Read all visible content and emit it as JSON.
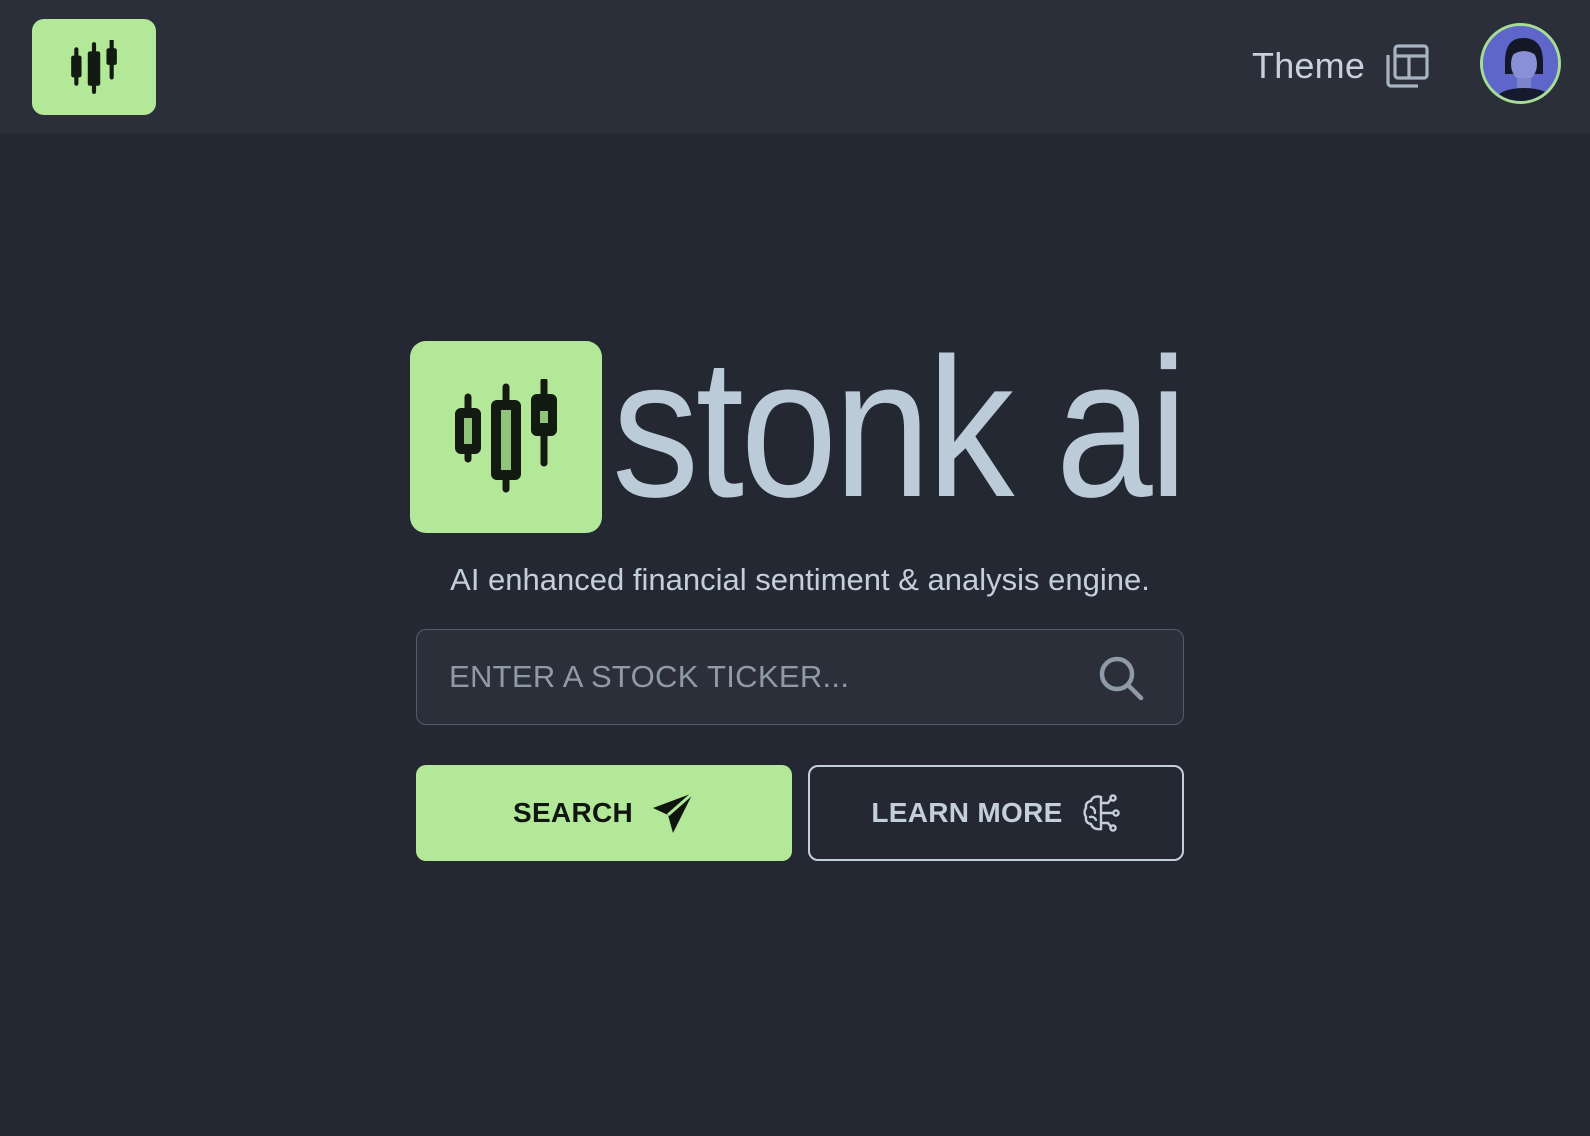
{
  "colors": {
    "accent": "#b2e897",
    "background": "#242833",
    "header_background": "#2b2f3a",
    "text": "#bccbd8",
    "icon_dark": "#121a12"
  },
  "header": {
    "logo_icon": "candlestick-chart-icon",
    "theme_label": "Theme",
    "theme_icon": "layout-windows-icon",
    "avatar_icon": "user-avatar"
  },
  "hero": {
    "logo_icon": "candlestick-chart-icon",
    "brand_name": "stonk ai",
    "tagline": "AI enhanced financial sentiment & analysis engine."
  },
  "search": {
    "placeholder": "ENTER A STOCK TICKER...",
    "value": "",
    "icon": "search-icon"
  },
  "actions": {
    "search_label": "SEARCH",
    "search_icon": "paper-plane-icon",
    "learn_more_label": "LEARN MORE",
    "learn_more_icon": "brain-circuit-icon"
  }
}
